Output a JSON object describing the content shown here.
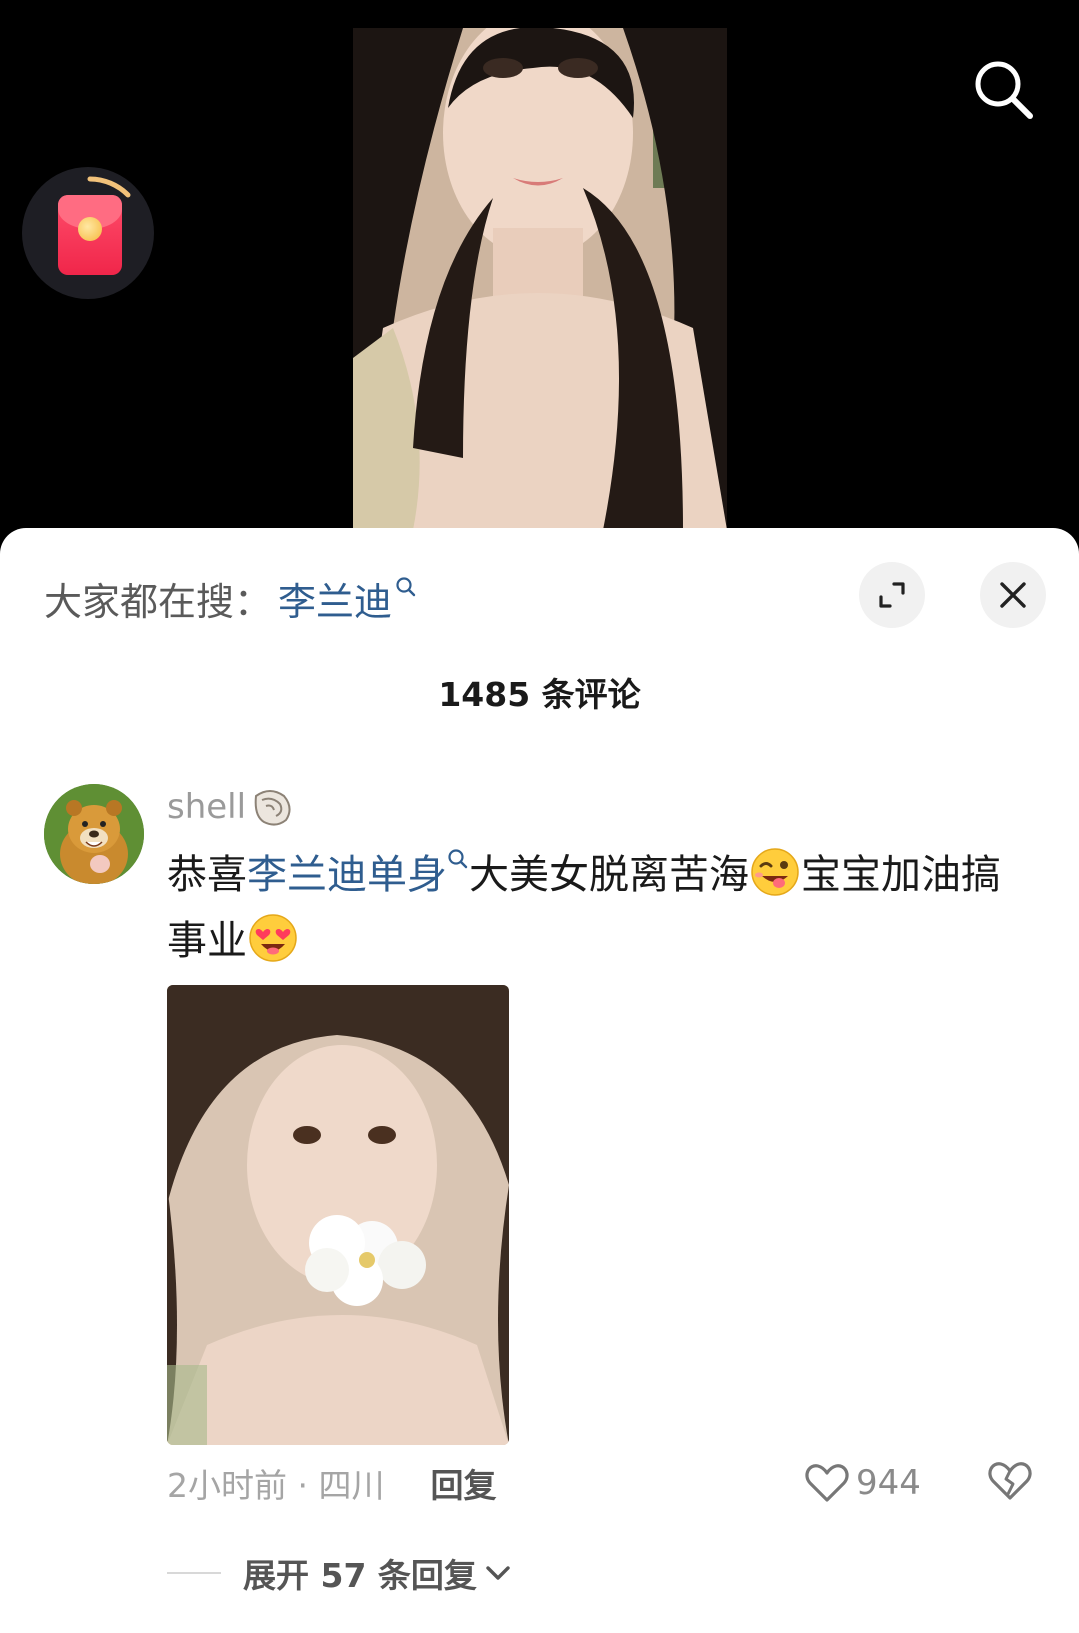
{
  "icons": {
    "search": "search-icon",
    "red_packet": "red-packet-icon",
    "expand": "expand-icon",
    "close": "close-icon",
    "keyword_search": "search-small-icon",
    "shell": "shell-icon",
    "like": "heart-icon",
    "dislike": "broken-heart-icon",
    "chevron": "chevron-down-icon"
  },
  "colors": {
    "link": "#2f5d8f",
    "red_packet": "#f0264a",
    "muted": "#9a9a9a"
  },
  "hot_search": {
    "label": "大家都在搜：",
    "keyword": "李兰迪"
  },
  "comments_header": {
    "count_label": "1485 条评论"
  },
  "comment": {
    "username": "shell",
    "text_prefix": "恭喜",
    "text_keyword": "李兰迪单身",
    "text_middle": "大美女脱离苦海",
    "text_after_emoji": "宝宝加油搞事业",
    "emoji_1": "wink-tongue-emoji",
    "emoji_2": "heart-eyes-emoji",
    "time_location": "2小时前 · 四川",
    "reply_label": "回复",
    "like_count": "944",
    "expand_replies_label": "展开 57 条回复"
  }
}
